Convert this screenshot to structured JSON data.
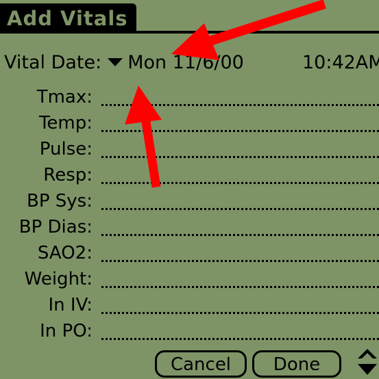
{
  "window": {
    "title": "Add Vitals"
  },
  "date_row": {
    "label": "Vital Date:",
    "date_value": "Mon 11/6/00",
    "time_value": "10:42AM"
  },
  "fields": [
    {
      "label": "Tmax:",
      "value": ""
    },
    {
      "label": "Temp:",
      "value": ""
    },
    {
      "label": "Pulse:",
      "value": ""
    },
    {
      "label": "Resp:",
      "value": ""
    },
    {
      "label": "BP Sys:",
      "value": ""
    },
    {
      "label": "BP Dias:",
      "value": ""
    },
    {
      "label": "SAO2:",
      "value": ""
    },
    {
      "label": "Weight:",
      "value": ""
    },
    {
      "label": "In IV:",
      "value": ""
    },
    {
      "label": "In PO:",
      "value": ""
    }
  ],
  "buttons": {
    "cancel_label": "Cancel",
    "done_label": "Done"
  },
  "icons": {
    "date_dropdown": "triangle-down-icon",
    "scroll": "scroll-arrows-icon"
  },
  "colors": {
    "screen_background": "#7e9467",
    "ink": "#000000",
    "annotation_arrow": "#ff0000"
  }
}
